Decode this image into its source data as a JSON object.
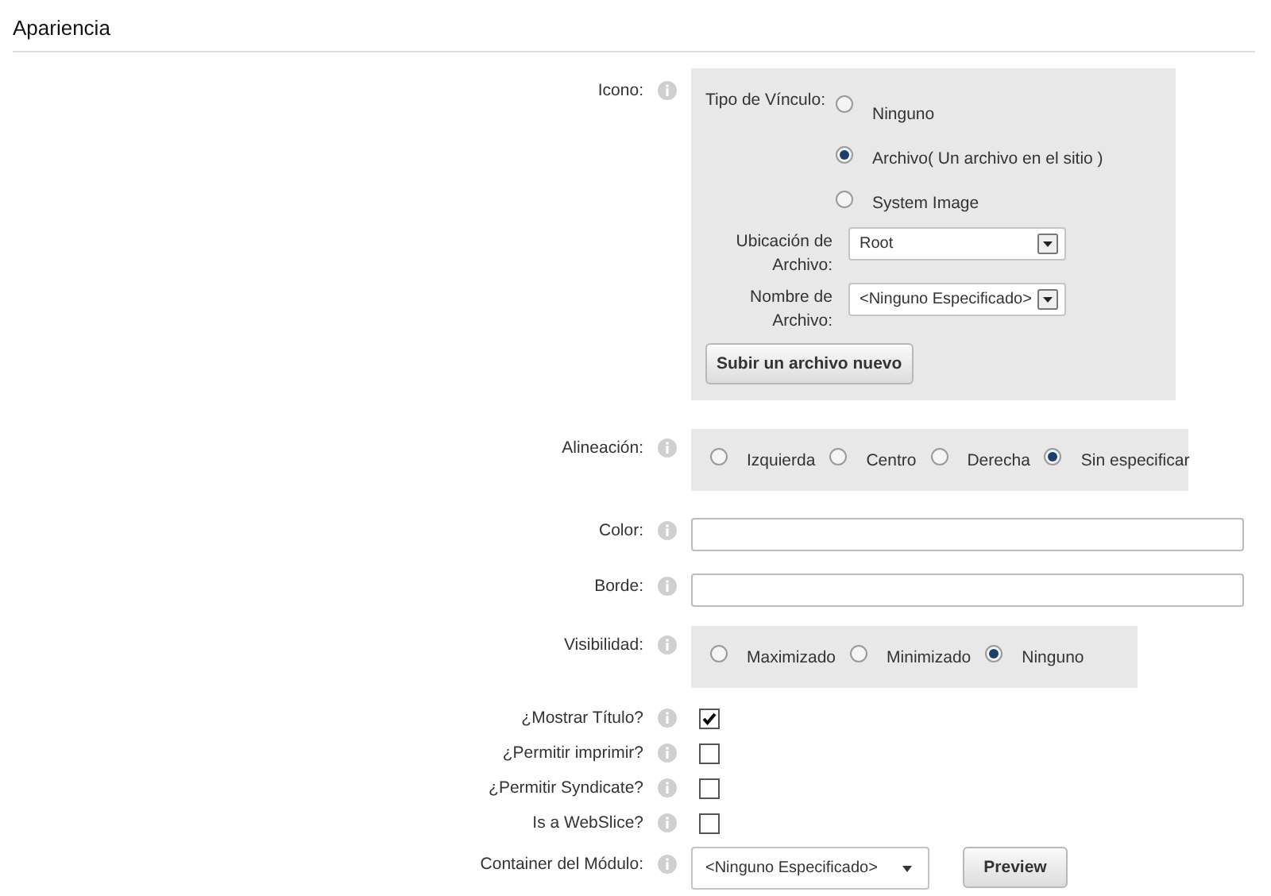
{
  "section": {
    "title": "Apariencia"
  },
  "icono": {
    "label": "Icono:",
    "link_type": {
      "label": "Tipo de Vínculo:",
      "options": [
        {
          "label": "Ninguno",
          "selected": false
        },
        {
          "label": "Archivo( Un archivo en el sitio )",
          "selected": true
        },
        {
          "label": "System Image",
          "selected": false
        }
      ]
    },
    "file_location": {
      "label": "Ubicación de Archivo:",
      "value": "Root"
    },
    "file_name": {
      "label": "Nombre de Archivo:",
      "value": "<Ninguno Especificado>"
    },
    "upload_button": "Subir un archivo nuevo"
  },
  "alignment": {
    "label": "Alineación:",
    "options": [
      {
        "label": "Izquierda",
        "selected": false
      },
      {
        "label": "Centro",
        "selected": false
      },
      {
        "label": "Derecha",
        "selected": false
      },
      {
        "label": "Sin especificar",
        "selected": true
      }
    ]
  },
  "color": {
    "label": "Color:"
  },
  "border": {
    "label": "Borde:"
  },
  "visibility": {
    "label": "Visibilidad:",
    "options": [
      {
        "label": "Maximizado",
        "selected": false
      },
      {
        "label": "Minimizado",
        "selected": false
      },
      {
        "label": "Ninguno",
        "selected": true
      }
    ]
  },
  "checkboxes": [
    {
      "label": "¿Mostrar Título?",
      "checked": true
    },
    {
      "label": "¿Permitir imprimir?",
      "checked": false
    },
    {
      "label": "¿Permitir Syndicate?",
      "checked": false
    },
    {
      "label": "Is a WebSlice?",
      "checked": false
    }
  ],
  "container": {
    "label": "Container del Módulo:",
    "value": "<Ninguno Especificado>",
    "preview_button": "Preview"
  }
}
